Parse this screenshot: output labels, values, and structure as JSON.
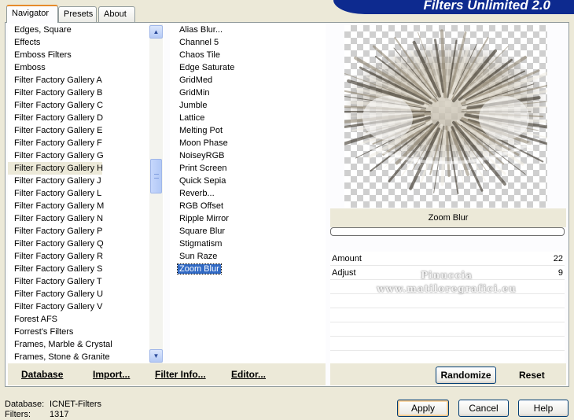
{
  "tabs": [
    "Navigator",
    "Presets",
    "About"
  ],
  "banner_title": "Filters Unlimited 2.0",
  "categories": [
    "Edges, Square",
    "Effects",
    "Emboss Filters",
    "Emboss",
    "Filter Factory Gallery A",
    "Filter Factory Gallery B",
    "Filter Factory Gallery C",
    "Filter Factory Gallery D",
    "Filter Factory Gallery E",
    "Filter Factory Gallery F",
    "Filter Factory Gallery G",
    "Filter Factory Gallery H",
    "Filter Factory Gallery J",
    "Filter Factory Gallery L",
    "Filter Factory Gallery M",
    "Filter Factory Gallery N",
    "Filter Factory Gallery P",
    "Filter Factory Gallery Q",
    "Filter Factory Gallery R",
    "Filter Factory Gallery S",
    "Filter Factory Gallery T",
    "Filter Factory Gallery U",
    "Filter Factory Gallery V",
    "Forest AFS",
    "Forrest's Filters",
    "Frames, Marble & Crystal",
    "Frames, Stone & Granite"
  ],
  "selected_category": "Filter Factory Gallery H",
  "filters": [
    "Alias Blur...",
    "Channel 5",
    "Chaos Tile",
    "Edge Saturate",
    "GridMed",
    "GridMin",
    "Jumble",
    "Lattice",
    "Melting Pot",
    "Moon Phase",
    "NoiseyRGB",
    "Print Screen",
    "Quick Sepia",
    "Reverb...",
    "RGB Offset",
    "Ripple Mirror",
    "Square Blur",
    "Stigmatism",
    "Sun Raze",
    "Zoom Blur"
  ],
  "selected_filter": "Zoom Blur",
  "filter_title": "Zoom Blur",
  "params": [
    {
      "label": "Amount",
      "value": "22"
    },
    {
      "label": "Adjust",
      "value": "9"
    }
  ],
  "watermark": [
    "Pinuccia",
    "www.matiloregrafici.eu"
  ],
  "toolbar": {
    "database": "Database",
    "import": "Import...",
    "filter_info": "Filter Info...",
    "editor": "Editor..."
  },
  "right_buttons": {
    "randomize": "Randomize",
    "reset": "Reset"
  },
  "dialog_buttons": {
    "apply": "Apply",
    "cancel": "Cancel",
    "help": "Help"
  },
  "status": {
    "database_label": "Database:",
    "database_value": "ICNET-Filters",
    "filters_label": "Filters:",
    "filters_value": "1317"
  }
}
